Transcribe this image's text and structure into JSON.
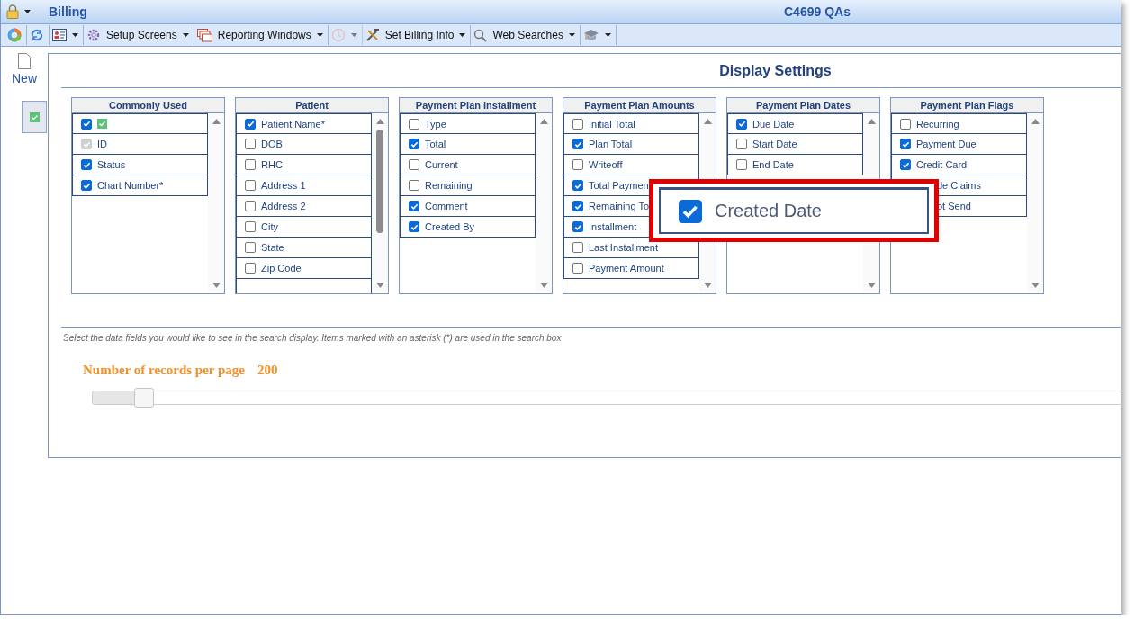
{
  "window": {
    "title": "Billing",
    "context": "C4699 QAs"
  },
  "toolbar": [
    {
      "kind": "icon"
    },
    {
      "kind": "icon"
    },
    {
      "kind": "menu"
    },
    {
      "kind": "menu",
      "label": "Setup Screens"
    },
    {
      "kind": "menu",
      "label": "Reporting Windows"
    },
    {
      "kind": "menu",
      "disabled": true
    },
    {
      "kind": "menu",
      "label": "Set Billing Info"
    },
    {
      "kind": "menu",
      "label": "Web Searches"
    },
    {
      "kind": "menu"
    }
  ],
  "new_button": {
    "label": "New"
  },
  "heading": "Display Settings",
  "lists": [
    {
      "title": "Commonly Used",
      "scrollable": false,
      "items": [
        {
          "kind": "icon",
          "checked": true
        },
        {
          "label": "ID",
          "checked": true,
          "disabled": true
        },
        {
          "label": "Status",
          "checked": true
        },
        {
          "label": "Chart Number*",
          "checked": true
        }
      ]
    },
    {
      "title": "Patient",
      "scrollable": true,
      "items": [
        {
          "label": "Patient Name*",
          "checked": true
        },
        {
          "label": "DOB",
          "checked": false
        },
        {
          "label": "RHC",
          "checked": false
        },
        {
          "label": "Address 1",
          "checked": false
        },
        {
          "label": "Address 2",
          "checked": false
        },
        {
          "label": "City",
          "checked": false
        },
        {
          "label": "State",
          "checked": false
        },
        {
          "label": "Zip Code",
          "checked": false
        },
        {
          "kind": "cut"
        }
      ]
    },
    {
      "title": "Payment Plan Installment",
      "scrollable": false,
      "items": [
        {
          "label": "Type",
          "checked": false
        },
        {
          "label": "Total",
          "checked": true
        },
        {
          "label": "Current",
          "checked": false
        },
        {
          "label": "Remaining",
          "checked": false
        },
        {
          "label": "Comment",
          "checked": true
        },
        {
          "label": "Created By",
          "checked": true
        }
      ]
    },
    {
      "title": "Payment Plan Amounts",
      "scrollable": false,
      "items": [
        {
          "label": "Initial Total",
          "checked": false
        },
        {
          "label": "Plan Total",
          "checked": true
        },
        {
          "label": "Writeoff",
          "checked": false
        },
        {
          "label": "Total Paymen",
          "checked": true
        },
        {
          "label": "Remaining To",
          "checked": true
        },
        {
          "label": "Installment",
          "checked": true
        },
        {
          "label": "Last Installment",
          "checked": false
        },
        {
          "label": "Payment Amount",
          "checked": false
        }
      ]
    },
    {
      "title": "Payment Plan Dates",
      "scrollable": false,
      "items": [
        {
          "label": "Due Date",
          "checked": true
        },
        {
          "label": "Start Date",
          "checked": false
        },
        {
          "label": "End Date",
          "checked": false
        }
      ]
    },
    {
      "title": "Payment Plan Flags",
      "scrollable": false,
      "items": [
        {
          "label": "Recurring",
          "checked": false
        },
        {
          "label": "Payment Due",
          "checked": true
        },
        {
          "label": "Credit Card",
          "checked": true
        },
        {
          "kind": "covered",
          "label": "de Claims"
        },
        {
          "kind": "covered",
          "label": "ot Send"
        }
      ]
    }
  ],
  "callout": {
    "label": "Created Date",
    "checked": true
  },
  "hint": "Select the data fields you would like to see in the search display. Items marked with an asterisk (*) are used in the search box",
  "records": {
    "label": "Number of records per page",
    "value": "200",
    "level": 0.05
  }
}
